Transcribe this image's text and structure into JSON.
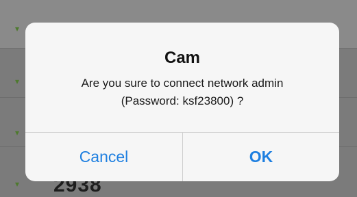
{
  "background": {
    "visible_row_text": "2938",
    "icon_name": "wifi-icon"
  },
  "dialog": {
    "title": "Cam",
    "message_line1": "Are you sure to connect network admin",
    "message_line2": "(Password: ksf23800) ?",
    "cancel_label": "Cancel",
    "ok_label": "OK"
  },
  "colors": {
    "button_text": "#1e7fe0",
    "dialog_bg": "#f6f6f6"
  }
}
